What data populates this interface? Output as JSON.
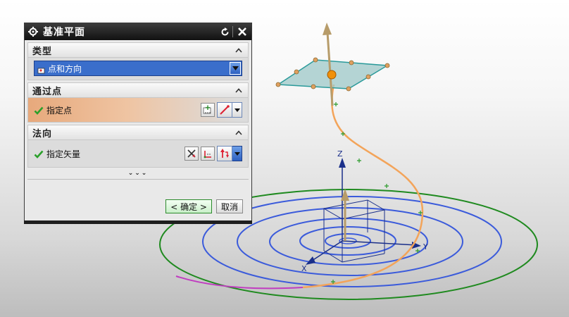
{
  "dialog": {
    "title": "基准平面",
    "sections": {
      "type": {
        "label": "类型",
        "selected": "点和方向"
      },
      "through_point": {
        "label": "通过点",
        "row_label": "指定点"
      },
      "normal": {
        "label": "法向",
        "row_label": "指定矢量"
      }
    },
    "more_label": "⌄⌄⌄",
    "ok_label": "< 确定 >",
    "cancel_label": "取消"
  },
  "axes": {
    "x": "X",
    "y": "Y",
    "z": "Z"
  },
  "colors": {
    "spiral": "#3b5bdb",
    "outer_ellipse": "#1f8a1f",
    "curve": "#f3a45a",
    "magenta_curve": "#c03cc0",
    "plane_fill": "#9ec8c8",
    "plane_edge": "#2a9a9a",
    "normal_vector": "#b79c6a",
    "axis_x": "#1a2f8a",
    "axis_y": "#1a2f8a",
    "axis_z": "#1a2f8a"
  },
  "icons": {
    "title": "gear-icon",
    "reset": "reset-icon",
    "close": "close-icon",
    "collapse": "chevron-up-icon",
    "type_item": "point-plane-icon",
    "check": "check-icon",
    "point_dialog": "point-dialog-icon",
    "inferred_point": "inferred-point-icon",
    "vector_dialog": "vector-dialog-icon",
    "vector_constructor": "vector-constructor-icon",
    "inferred_vector": "inferred-vector-icon",
    "dropdown": "chevron-down-icon"
  }
}
